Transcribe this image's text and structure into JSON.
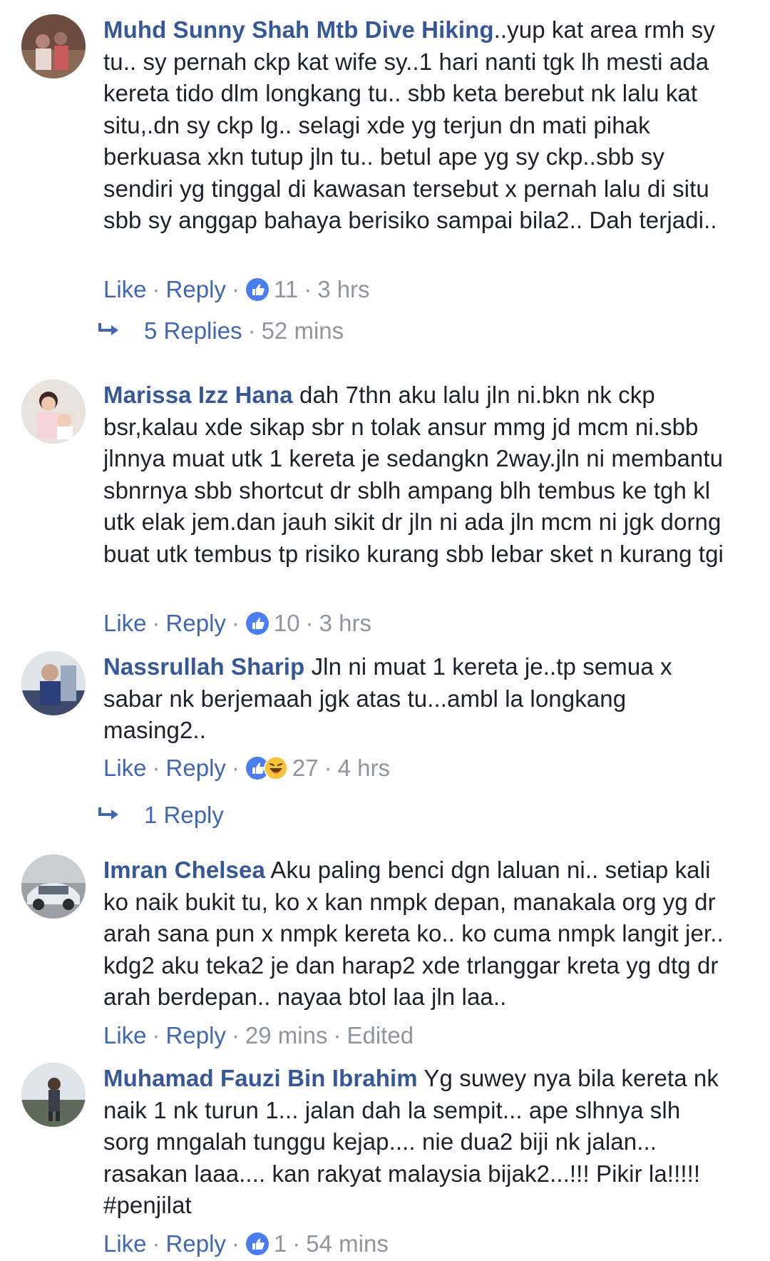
{
  "comments": [
    {
      "author": "Muhd Sunny Shah Mtb Dive Hiking",
      "text": "..yup kat area rmh sy tu.. sy pernah ckp kat wife sy..1 hari nanti tgk lh mesti ada kereta tido dlm longkang tu.. sbb keta berebut nk lalu kat situ,.dn sy ckp lg.. selagi xde yg terjun dn mati pihak berkuasa xkn tutup jln tu.. betul ape yg sy ckp..sbb sy sendiri yg tinggal di kawasan tersebut x pernah lalu di situ sbb sy anggap bahaya berisiko sampai bila2.. Dah terjadi..",
      "like_label": "Like",
      "reply_label": "Reply",
      "reactions": [
        "like"
      ],
      "reaction_count": "11",
      "time": "3 hrs",
      "replies_label": "5 Replies",
      "replies_time": "52 mins"
    },
    {
      "author": "Marissa Izz Hana",
      "text": "dah 7thn aku lalu jln ni.bkn nk ckp bsr,kalau xde sikap sbr n tolak ansur mmg jd mcm ni.sbb jlnnya muat utk 1 kereta je sedangkn 2way.jln ni membantu sbnrnya sbb shortcut dr sblh ampang blh tembus ke tgh kl utk elak jem.dan jauh sikit dr jln ni ada jln mcm ni jgk dorng buat utk tembus tp risiko kurang sbb lebar sket n kurang tgi",
      "like_label": "Like",
      "reply_label": "Reply",
      "reactions": [
        "like"
      ],
      "reaction_count": "10",
      "time": "3 hrs"
    },
    {
      "author": "Nassrullah Sharip",
      "text": "Jln ni muat 1 kereta je..tp semua x sabar nk berjemaah jgk atas tu...ambl la longkang masing2..",
      "like_label": "Like",
      "reply_label": "Reply",
      "reactions": [
        "like",
        "haha"
      ],
      "reaction_count": "27",
      "time": "4 hrs",
      "replies_label": "1 Reply"
    },
    {
      "author": "Imran Chelsea",
      "text": "Aku paling benci dgn laluan ni.. setiap kali ko naik bukit tu, ko x kan nmpk depan, manakala org yg dr arah sana pun x nmpk kereta ko.. ko cuma nmpk langit jer.. kdg2 aku teka2 je dan harap2 xde trlanggar kreta yg dtg dr arah berdepan.. nayaa btol laa jln laa..",
      "like_label": "Like",
      "reply_label": "Reply",
      "time": "29 mins",
      "edited_label": "Edited"
    },
    {
      "author": "Muhamad Fauzi Bin Ibrahim",
      "text": "Yg suwey nya bila kereta nk naik 1 nk turun 1... jalan dah la sempit... ape slhnya slh sorg mngalah tunggu kejap.... nie dua2 biji nk jalan... rasakan laaa.... kan rakyat malaysia bijak2...!!! Pikir la!!!!! #penjilat",
      "like_label": "Like",
      "reply_label": "Reply",
      "reactions": [
        "like"
      ],
      "reaction_count": "1",
      "time": "54 mins"
    }
  ],
  "colors": {
    "author_name": "#365899",
    "action_link": "#4267b2",
    "meta_gray": "#90949c",
    "like_blue": "#4a7ef0",
    "haha_yellow": "#f7c33a"
  },
  "icons": {
    "like": "like-reaction-icon",
    "haha": "haha-reaction-icon",
    "reply_arrow": "reply-arrow-icon"
  }
}
